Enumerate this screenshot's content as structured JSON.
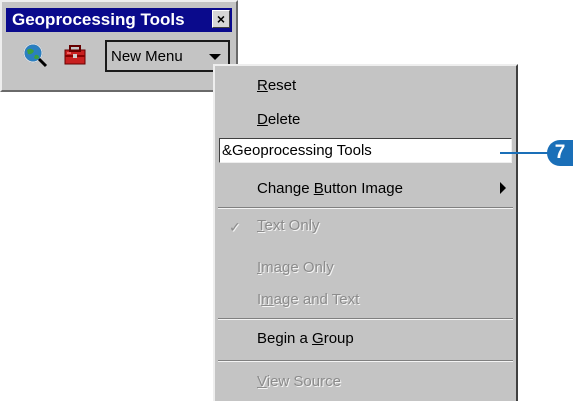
{
  "toolbar": {
    "title": "Geoprocessing Tools",
    "close_glyph": "×",
    "icons": [
      "globe-search-icon",
      "toolbox-icon"
    ],
    "new_menu_label": "New Menu"
  },
  "context_menu": {
    "reset": {
      "prefix": "",
      "accel": "R",
      "rest": "eset"
    },
    "delete": {
      "prefix": "",
      "accel": "D",
      "rest": "elete"
    },
    "name_value": "&Geoprocessing Tools",
    "change_button_image": {
      "prefix": "Change ",
      "accel": "B",
      "rest": "utton Image"
    },
    "text_only": {
      "prefix": "",
      "accel": "T",
      "rest": "ext Only",
      "checked": true,
      "enabled": false
    },
    "image_only": {
      "prefix": "",
      "accel": "I",
      "rest": "mage Only",
      "enabled": false
    },
    "image_and_text": {
      "prefix": "I",
      "accel": "m",
      "rest": "age and Text",
      "enabled": false
    },
    "begin_group": {
      "prefix": "Begin a ",
      "accel": "G",
      "rest": "roup"
    },
    "view_source": {
      "prefix": "",
      "accel": "V",
      "rest": "iew Source",
      "enabled": false
    },
    "check_glyph": "✓"
  },
  "callout": {
    "number": "7",
    "color": "#1a6fb8"
  },
  "colors": {
    "titlebar": "#0a0a8c",
    "chrome": "#c4c4c4",
    "disabled_text": "#8c8c8c"
  }
}
